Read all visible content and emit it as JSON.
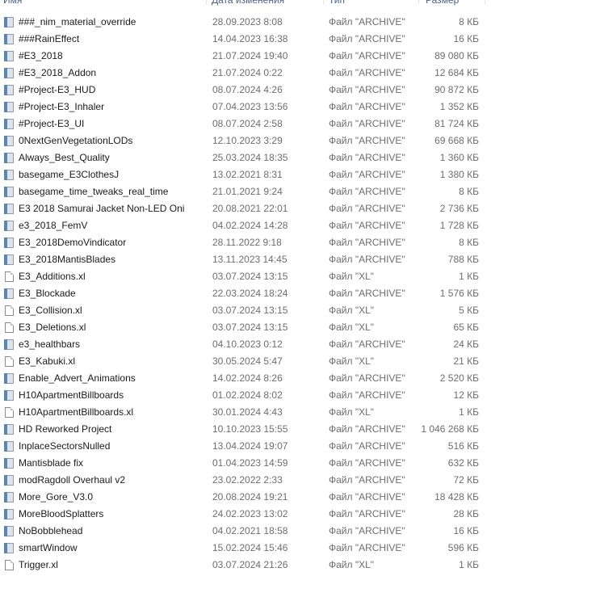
{
  "columns": {
    "name": "Имя",
    "date": "Дата изменения",
    "type": "Тип",
    "size": "Размер"
  },
  "files": [
    {
      "name": "###_nim_material_override",
      "date": "28.09.2023 8:08",
      "type": "Файл \"ARCHIVE\"",
      "size": "8 КБ",
      "icon": "archive-file-icon"
    },
    {
      "name": "###RainEffect",
      "date": "14.04.2023 16:38",
      "type": "Файл \"ARCHIVE\"",
      "size": "16 КБ",
      "icon": "archive-file-icon"
    },
    {
      "name": "#E3_2018",
      "date": "21.07.2024 19:40",
      "type": "Файл \"ARCHIVE\"",
      "size": "89 080 КБ",
      "icon": "archive-file-icon"
    },
    {
      "name": "#E3_2018_Addon",
      "date": "21.07.2024 0:22",
      "type": "Файл \"ARCHIVE\"",
      "size": "12 684 КБ",
      "icon": "archive-file-icon"
    },
    {
      "name": "#Project-E3_HUD",
      "date": "08.07.2024 4:26",
      "type": "Файл \"ARCHIVE\"",
      "size": "90 872 КБ",
      "icon": "archive-file-icon"
    },
    {
      "name": "#Project-E3_Inhaler",
      "date": "07.04.2023 13:56",
      "type": "Файл \"ARCHIVE\"",
      "size": "1 352 КБ",
      "icon": "archive-file-icon"
    },
    {
      "name": "#Project-E3_UI",
      "date": "08.07.2024 2:58",
      "type": "Файл \"ARCHIVE\"",
      "size": "81 724 КБ",
      "icon": "archive-file-icon"
    },
    {
      "name": "0NextGenVegetationLODs",
      "date": "12.10.2023 3:29",
      "type": "Файл \"ARCHIVE\"",
      "size": "69 668 КБ",
      "icon": "archive-file-icon"
    },
    {
      "name": "Always_Best_Quality",
      "date": "25.03.2024 18:35",
      "type": "Файл \"ARCHIVE\"",
      "size": "1 360 КБ",
      "icon": "archive-file-icon"
    },
    {
      "name": "basegame_E3ClothesJ",
      "date": "13.02.2021 8:31",
      "type": "Файл \"ARCHIVE\"",
      "size": "1 380 КБ",
      "icon": "archive-file-icon"
    },
    {
      "name": "basegame_time_tweaks_real_time",
      "date": "21.01.2021 9:24",
      "type": "Файл \"ARCHIVE\"",
      "size": "8 КБ",
      "icon": "archive-file-icon"
    },
    {
      "name": "E3 2018 Samurai Jacket Non-LED Oni",
      "date": "20.08.2021 22:01",
      "type": "Файл \"ARCHIVE\"",
      "size": "2 736 КБ",
      "icon": "archive-file-icon"
    },
    {
      "name": "e3_2018_FemV",
      "date": "04.02.2024 14:28",
      "type": "Файл \"ARCHIVE\"",
      "size": "1 728 КБ",
      "icon": "archive-file-icon"
    },
    {
      "name": "E3_2018DemoVindicator",
      "date": "28.11.2022 9:18",
      "type": "Файл \"ARCHIVE\"",
      "size": "8 КБ",
      "icon": "archive-file-icon"
    },
    {
      "name": "E3_2018MantisBlades",
      "date": "13.11.2023 14:45",
      "type": "Файл \"ARCHIVE\"",
      "size": "788 КБ",
      "icon": "archive-file-icon"
    },
    {
      "name": "E3_Additions.xl",
      "date": "03.07.2024 13:15",
      "type": "Файл \"XL\"",
      "size": "1 КБ",
      "icon": "blank-file-icon"
    },
    {
      "name": "E3_Blockade",
      "date": "22.03.2024 18:24",
      "type": "Файл \"ARCHIVE\"",
      "size": "1 576 КБ",
      "icon": "archive-file-icon"
    },
    {
      "name": "E3_Collision.xl",
      "date": "03.07.2024 13:15",
      "type": "Файл \"XL\"",
      "size": "5 КБ",
      "icon": "blank-file-icon"
    },
    {
      "name": "E3_Deletions.xl",
      "date": "03.07.2024 13:15",
      "type": "Файл \"XL\"",
      "size": "65 КБ",
      "icon": "blank-file-icon"
    },
    {
      "name": "e3_healthbars",
      "date": "04.10.2023 0:12",
      "type": "Файл \"ARCHIVE\"",
      "size": "24 КБ",
      "icon": "archive-file-icon"
    },
    {
      "name": "E3_Kabuki.xl",
      "date": "30.05.2024 5:47",
      "type": "Файл \"XL\"",
      "size": "21 КБ",
      "icon": "blank-file-icon"
    },
    {
      "name": "Enable_Advert_Animations",
      "date": "14.02.2024 8:26",
      "type": "Файл \"ARCHIVE\"",
      "size": "2 520 КБ",
      "icon": "archive-file-icon"
    },
    {
      "name": "H10ApartmentBillboards",
      "date": "01.02.2024 8:02",
      "type": "Файл \"ARCHIVE\"",
      "size": "12 КБ",
      "icon": "archive-file-icon"
    },
    {
      "name": "H10ApartmentBillboards.xl",
      "date": "30.01.2024 4:43",
      "type": "Файл \"XL\"",
      "size": "1 КБ",
      "icon": "blank-file-icon"
    },
    {
      "name": "HD Reworked Project",
      "date": "10.10.2023 15:55",
      "type": "Файл \"ARCHIVE\"",
      "size": "1 046 268 КБ",
      "icon": "archive-file-icon"
    },
    {
      "name": "InplaceSectorsNulled",
      "date": "13.04.2024 19:07",
      "type": "Файл \"ARCHIVE\"",
      "size": "516 КБ",
      "icon": "archive-file-icon"
    },
    {
      "name": "Mantisblade fix",
      "date": "01.04.2023 14:59",
      "type": "Файл \"ARCHIVE\"",
      "size": "632 КБ",
      "icon": "archive-file-icon"
    },
    {
      "name": "modRagdoll Overhaul v2",
      "date": "23.02.2022 2:33",
      "type": "Файл \"ARCHIVE\"",
      "size": "72 КБ",
      "icon": "archive-file-icon"
    },
    {
      "name": "More_Gore_V3.0",
      "date": "20.08.2024 19:21",
      "type": "Файл \"ARCHIVE\"",
      "size": "18 428 КБ",
      "icon": "archive-file-icon"
    },
    {
      "name": "MoreBloodSplatters",
      "date": "24.02.2023 13:02",
      "type": "Файл \"ARCHIVE\"",
      "size": "28 КБ",
      "icon": "archive-file-icon"
    },
    {
      "name": "NoBobblehead",
      "date": "04.02.2021 18:58",
      "type": "Файл \"ARCHIVE\"",
      "size": "16 КБ",
      "icon": "archive-file-icon"
    },
    {
      "name": "smartWindow",
      "date": "15.02.2024 15:46",
      "type": "Файл \"ARCHIVE\"",
      "size": "596 КБ",
      "icon": "archive-file-icon"
    },
    {
      "name": "Trigger.xl",
      "date": "03.07.2024 21:26",
      "type": "Файл \"XL\"",
      "size": "1 КБ",
      "icon": "blank-file-icon"
    }
  ],
  "colors": {
    "header_text": "#4d6082",
    "name_text": "#1a1a1a",
    "meta_text": "#6d6d6d",
    "archive_icon_band": "#5d84ad"
  }
}
